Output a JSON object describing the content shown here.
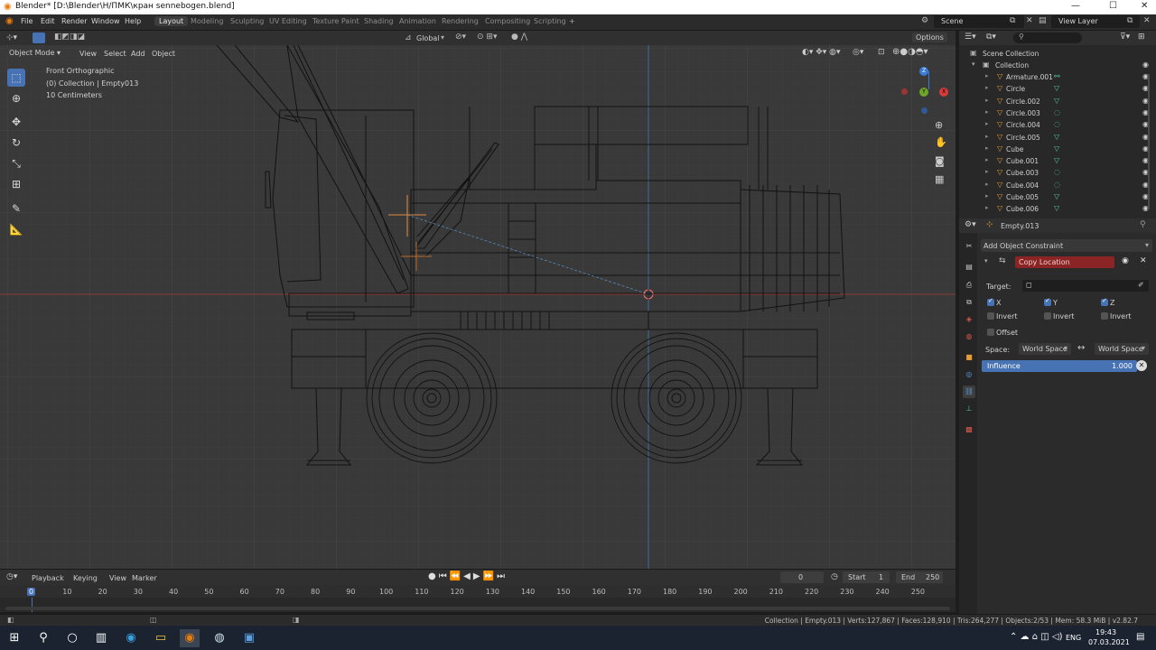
{
  "window": {
    "title": "Blender* [D:\\Blender\\Н/ПМК\\кран sennebogen.blend]",
    "controls": [
      "—",
      "☐",
      "✕"
    ]
  },
  "menus": [
    "File",
    "Edit",
    "Render",
    "Window",
    "Help"
  ],
  "workspaces": [
    "Layout",
    "Modeling",
    "Sculpting",
    "UV Editing",
    "Texture Paint",
    "Shading",
    "Animation",
    "Rendering",
    "Compositing",
    "Scripting"
  ],
  "active_workspace": "Layout",
  "scene": {
    "name": "Scene",
    "view_layer": "View Layer"
  },
  "viewport_header": {
    "mode": "Object Mode",
    "menus": [
      "View",
      "Select",
      "Add",
      "Object"
    ],
    "orientation": "Global",
    "options": "Options"
  },
  "viewport_overlay": {
    "view": "Front Orthographic",
    "collection": "(0) Collection | Empty013",
    "scale": "10 Centimeters"
  },
  "gizmo": {
    "x": "X",
    "y": "Y",
    "z": "Z"
  },
  "outliner": {
    "search_placeholder": "",
    "root": "Scene Collection",
    "collection": "Collection",
    "items": [
      {
        "name": "Armature.001",
        "data": "⚯"
      },
      {
        "name": "Circle",
        "data": "▽"
      },
      {
        "name": "Circle.002",
        "data": "▽"
      },
      {
        "name": "Circle.003",
        "data": "◌"
      },
      {
        "name": "Circle.004",
        "data": "◌"
      },
      {
        "name": "Circle.005",
        "data": "▽"
      },
      {
        "name": "Cube",
        "data": "▽"
      },
      {
        "name": "Cube.001",
        "data": "▽"
      },
      {
        "name": "Cube.003",
        "data": "◌"
      },
      {
        "name": "Cube.004",
        "data": "◌"
      },
      {
        "name": "Cube.005",
        "data": "▽"
      },
      {
        "name": "Cube.006",
        "data": "▽"
      }
    ]
  },
  "properties": {
    "object": "Empty.013",
    "add_constraint": "Add Object Constraint",
    "constraint_name": "Copy Location",
    "target_label": "Target:",
    "axes": [
      {
        "label": "X",
        "invert": "Invert"
      },
      {
        "label": "Y",
        "invert": "Invert"
      },
      {
        "label": "Z",
        "invert": "Invert"
      }
    ],
    "offset": "Offset",
    "space_label": "Space:",
    "owner_space": "World Space",
    "target_space": "World Space",
    "influence_label": "Influence",
    "influence_value": "1.000",
    "influence_fraction": 1.0
  },
  "timeline": {
    "menus": [
      "Playback",
      "Keying",
      "View",
      "Marker"
    ],
    "current_frame": "0",
    "start_label": "Start",
    "start": "1",
    "end_label": "End",
    "end": "250",
    "ticks": [
      "0",
      "10",
      "20",
      "30",
      "40",
      "50",
      "60",
      "70",
      "80",
      "90",
      "100",
      "110",
      "120",
      "130",
      "140",
      "150",
      "160",
      "170",
      "180",
      "190",
      "200",
      "210",
      "220",
      "230",
      "240",
      "250"
    ]
  },
  "statusbar": {
    "stats": "Collection | Empty.013 | Verts:127,867 | Faces:128,910 | Tris:264,277 | Objects:2/53 | Mem: 58.3 MiB | v2.82.7"
  },
  "taskbar": {
    "lang": "ENG",
    "time": "19:43",
    "date": "07.03.2021"
  }
}
